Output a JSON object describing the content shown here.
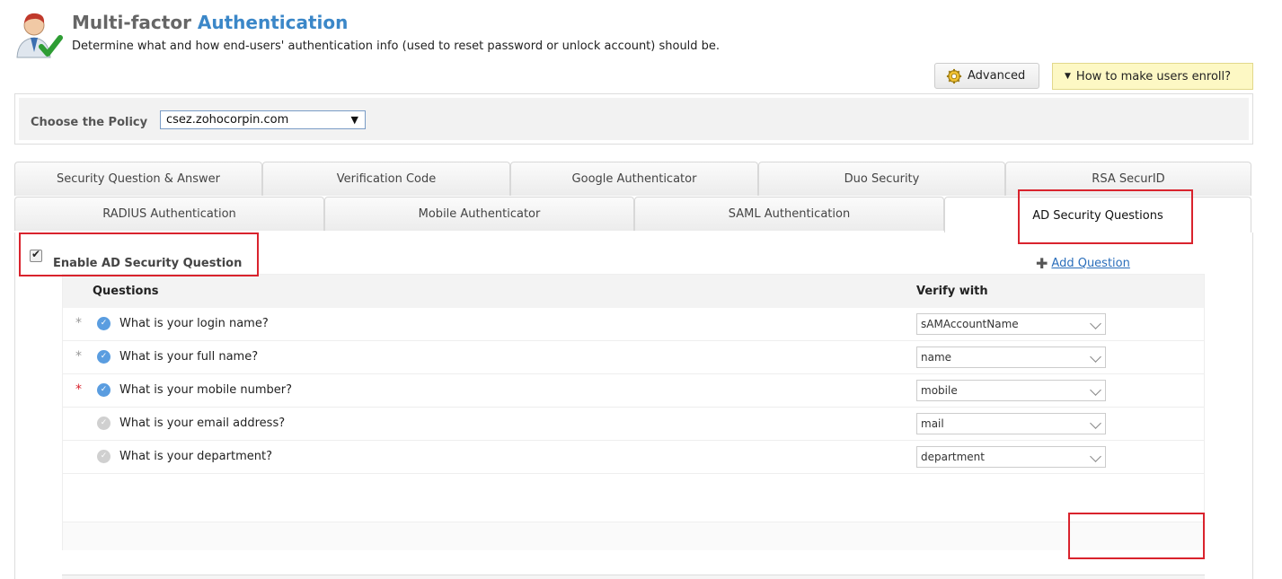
{
  "header": {
    "title_part1": "Multi-factor",
    "title_part2": "Authentication",
    "subtitle": "Determine what and how end-users' authentication info (used to reset password or unlock account) should be.",
    "logo_icon": "user-check-icon"
  },
  "toolbar": {
    "advanced_label": "Advanced",
    "advanced_icon": "gear-icon",
    "help_label": "How to make users enroll?",
    "help_icon": "caret-down-icon"
  },
  "policy": {
    "label": "Choose the Policy",
    "selected": "csez.zohocorpin.com"
  },
  "tabs_row1": [
    {
      "label": "Security Question & Answer"
    },
    {
      "label": "Verification Code"
    },
    {
      "label": "Google Authenticator"
    },
    {
      "label": "Duo Security"
    },
    {
      "label": "RSA SecurID"
    }
  ],
  "tabs_row2": [
    {
      "label": "RADIUS Authentication"
    },
    {
      "label": "Mobile Authenticator"
    },
    {
      "label": "SAML Authentication"
    },
    {
      "label": "AD Security Questions",
      "active": true
    }
  ],
  "enable": {
    "label": "Enable AD Security Question",
    "checked": true
  },
  "grid": {
    "col_questions": "Questions",
    "col_verify": "Verify with",
    "rows": [
      {
        "star": "*",
        "required": false,
        "enabled": true,
        "question": "What is your login name?",
        "verify": "sAMAccountName"
      },
      {
        "star": "*",
        "required": false,
        "enabled": true,
        "question": "What is your full name?",
        "verify": "name"
      },
      {
        "star": "*",
        "required": true,
        "enabled": true,
        "question": "What is your mobile number?",
        "verify": "mobile"
      },
      {
        "star": "",
        "required": false,
        "enabled": false,
        "question": "What is your email address?",
        "verify": "mail"
      },
      {
        "star": "",
        "required": false,
        "enabled": false,
        "question": "What is your department?",
        "verify": "department"
      }
    ]
  },
  "add_question": {
    "label": "Add Question",
    "icon": "plus-icon"
  },
  "colors": {
    "accent": "#3b87c8",
    "highlight": "#d9232d",
    "check_on": "#5a9de0",
    "check_off": "#d0d0d0",
    "help_bg": "#fdf8c4"
  }
}
